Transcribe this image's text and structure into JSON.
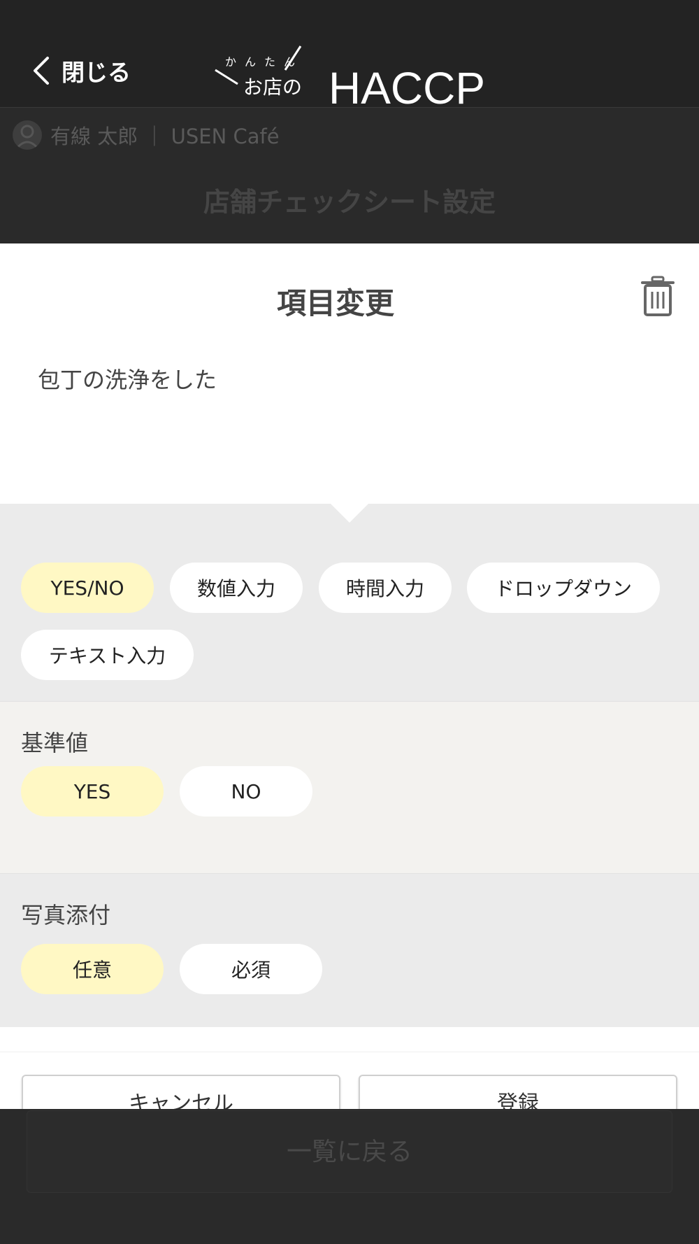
{
  "header": {
    "close_label": "閉じる",
    "logo_kana": "かんたん",
    "logo_shop": "お店の",
    "logo_brand": "HACCP"
  },
  "user": {
    "name": "有線 太郎 ｜ USEN Café"
  },
  "background": {
    "page_title": "店舗チェックシート設定"
  },
  "modal": {
    "title": "項目変更",
    "item_name": "包丁の洗浄をした",
    "input_types": [
      {
        "label": "YES/NO",
        "selected": true
      },
      {
        "label": "数値入力",
        "selected": false
      },
      {
        "label": "時間入力",
        "selected": false
      },
      {
        "label": "ドロップダウン",
        "selected": false
      },
      {
        "label": "テキスト入力",
        "selected": false
      }
    ],
    "standard": {
      "label": "基準値",
      "options": [
        {
          "label": "YES",
          "selected": true
        },
        {
          "label": "NO",
          "selected": false
        }
      ]
    },
    "photo": {
      "label": "写真添付",
      "options": [
        {
          "label": "任意",
          "selected": true
        },
        {
          "label": "必須",
          "selected": false
        }
      ]
    },
    "cancel_label": "キャンセル",
    "register_label": "登録"
  },
  "bottom": {
    "back_label": "一覧に戻る"
  },
  "colors": {
    "selected_pill": "#fff8c4",
    "header_bg": "#232323",
    "panel_gray": "#ebebeb",
    "panel_beige": "#f3f2ef"
  },
  "icons": [
    "chevron-left-icon",
    "user-icon",
    "trash-icon"
  ]
}
